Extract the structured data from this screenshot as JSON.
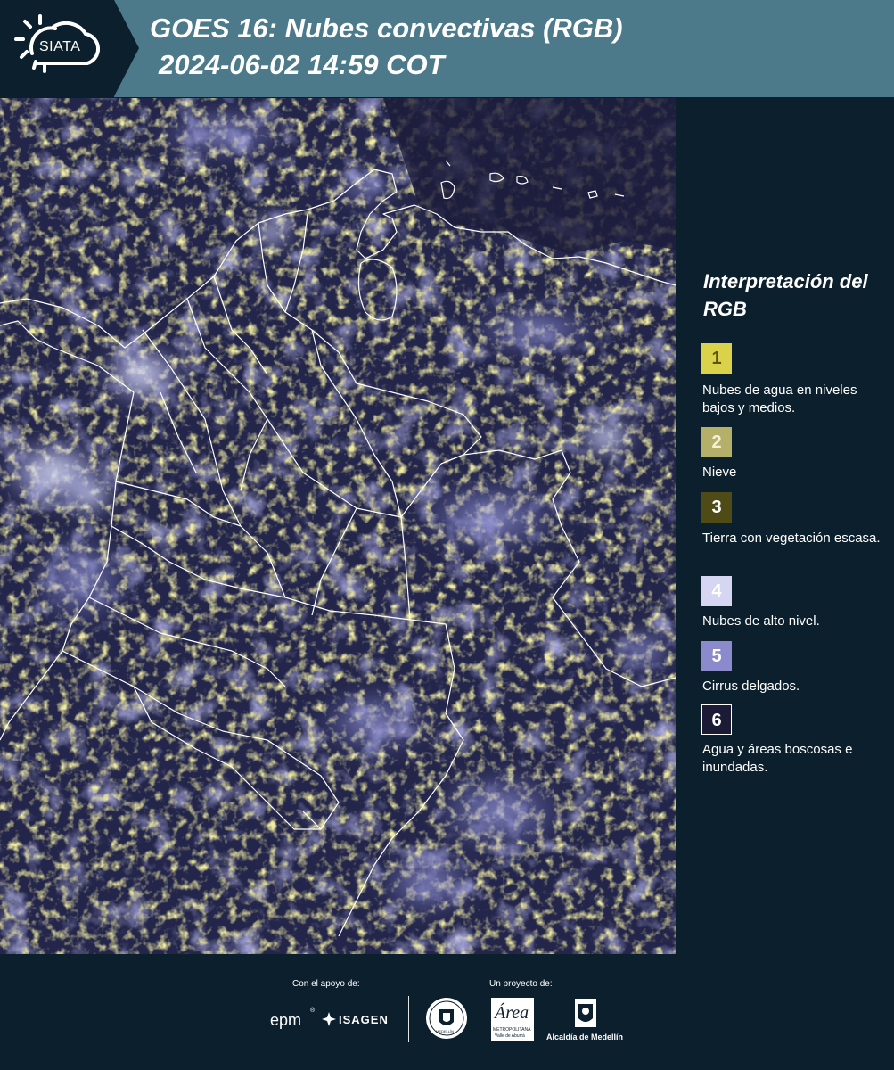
{
  "header": {
    "logo_text": "SIATA",
    "title": "GOES 16: Nubes convectivas (RGB)",
    "timestamp": "2024-06-02 14:59 COT",
    "background_color": "#4d7a8a",
    "logo_block_color": "#0c1f2c"
  },
  "map": {
    "type": "satellite-rgb-composite",
    "region": "Colombia",
    "boundaries": [
      "coastlines",
      "national borders",
      "department borders"
    ],
    "boundary_color": "#ffffff"
  },
  "legend": {
    "title": "Interpretación del RGB",
    "items": [
      {
        "number": "1",
        "label": "Nubes de agua en niveles bajos y medios.",
        "color": "#d9d24a",
        "text_color": "#5a5410"
      },
      {
        "number": "2",
        "label": "Nieve",
        "color": "#b5b069",
        "text_color": "#f4f1d8"
      },
      {
        "number": "3",
        "label": "Tierra con vegetación escasa.",
        "color": "#4e4b17",
        "text_color": "#ffffff"
      },
      {
        "number": "4",
        "label": "Nubes de alto nivel.",
        "color": "#d6d6f2",
        "text_color": "#ffffff"
      },
      {
        "number": "5",
        "label": "Cirrus delgados.",
        "color": "#8a8acd",
        "text_color": "#ffffff"
      },
      {
        "number": "6",
        "label": "Agua y áreas boscosas e inundadas.",
        "color": "#1c1b35",
        "text_color": "#ffffff"
      }
    ]
  },
  "footer": {
    "support_label": "Con el apoyo de:",
    "project_label": "Un proyecto de:",
    "sponsors": [
      "epm",
      "ISAGEN"
    ],
    "partners": [
      "Universidad de Medellín",
      "Área Metropolitana Valle de Aburrá",
      "Alcaldía de Medellín"
    ],
    "partner_texts": {
      "udem": "MEDELLÍN",
      "area_script": "Área",
      "area_line1": "METROPOLITANA",
      "area_line2": "Valle de Aburrá",
      "alcaldia": "Alcaldía de Medellín"
    }
  }
}
